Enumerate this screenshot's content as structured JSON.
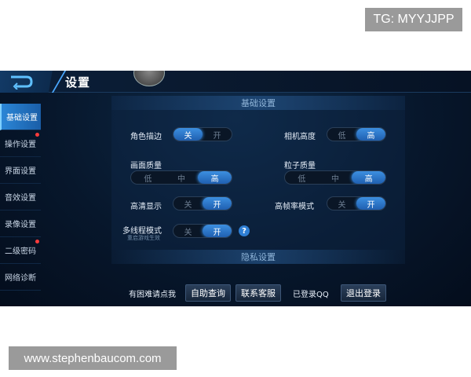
{
  "watermark_top": "TG: MYYJJPP",
  "watermark_bottom": "www.stephenbaucom.com",
  "header": {
    "title": "设置"
  },
  "sidebar": {
    "items": [
      {
        "label": "基础设置",
        "active": true,
        "dot": false
      },
      {
        "label": "操作设置",
        "active": false,
        "dot": true
      },
      {
        "label": "界面设置",
        "active": false,
        "dot": false
      },
      {
        "label": "音效设置",
        "active": false,
        "dot": false
      },
      {
        "label": "录像设置",
        "active": false,
        "dot": false
      },
      {
        "label": "二级密码",
        "active": false,
        "dot": true
      },
      {
        "label": "网络诊断",
        "active": false,
        "dot": false
      }
    ]
  },
  "sections": {
    "basic": "基础设置",
    "privacy": "隐私设置"
  },
  "settings": {
    "outline": {
      "label": "角色描边",
      "options": [
        "关",
        "开"
      ],
      "selected": 0
    },
    "camera": {
      "label": "相机高度",
      "options": [
        "低",
        "高"
      ],
      "selected": 1
    },
    "quality": {
      "label": "画面质量",
      "options": [
        "低",
        "中",
        "高"
      ],
      "selected": 2
    },
    "particle": {
      "label": "粒子质量",
      "options": [
        "低",
        "中",
        "高"
      ],
      "selected": 2
    },
    "hd": {
      "label": "高清显示",
      "options": [
        "关",
        "开"
      ],
      "selected": 1
    },
    "highfps": {
      "label": "高帧率模式",
      "options": [
        "关",
        "开"
      ],
      "selected": 1
    },
    "multithread": {
      "label": "多线程模式",
      "note": "重启游戏生效",
      "options": [
        "关",
        "开"
      ],
      "selected": 1
    }
  },
  "help_icon_text": "?",
  "bottom": {
    "help_text": "有困难请点我",
    "self_query": "自助查询",
    "contact": "联系客服",
    "login_state": "已登录QQ",
    "logout": "退出登录"
  },
  "colors": {
    "accent": "#2f7fd4",
    "active_tab": "#2b86d6",
    "dot": "#ff3b3b"
  }
}
